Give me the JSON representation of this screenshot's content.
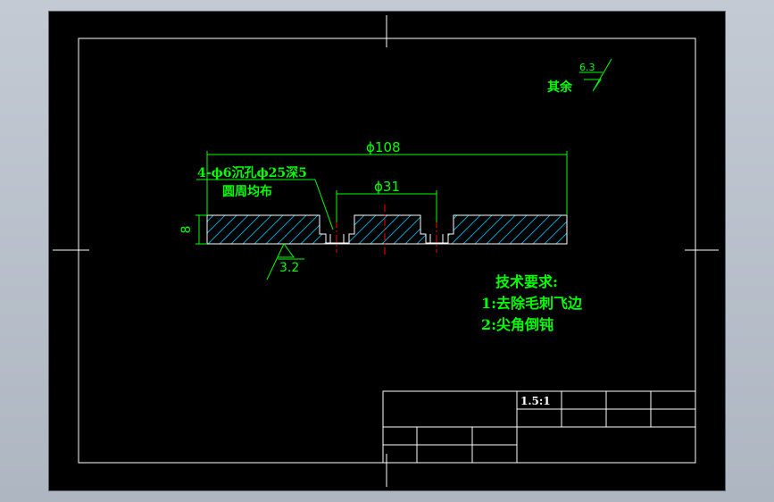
{
  "annotations": {
    "dim_overall_diameter": "ϕ108",
    "dim_bolt_circle": "ϕ31",
    "dim_thickness": "8",
    "hole_note_line1": "4-ϕ6沉孔ϕ25深5",
    "hole_note_line2": "圆周均布",
    "surface_finish_face": "3.2",
    "surface_finish_rest_label": "其余",
    "surface_finish_rest_value": "6.3"
  },
  "tech_requirements": {
    "title": "技术要求:",
    "items": [
      "1:去除毛刺飞边",
      "2:尖角倒钝"
    ]
  },
  "title_block": {
    "scale": "1.5:1"
  },
  "colors": {
    "background": "#000000",
    "frame": "#ffffff",
    "annotation": "#00ff00",
    "hatch": "#00c8ff",
    "centerline": "#ff0000"
  }
}
